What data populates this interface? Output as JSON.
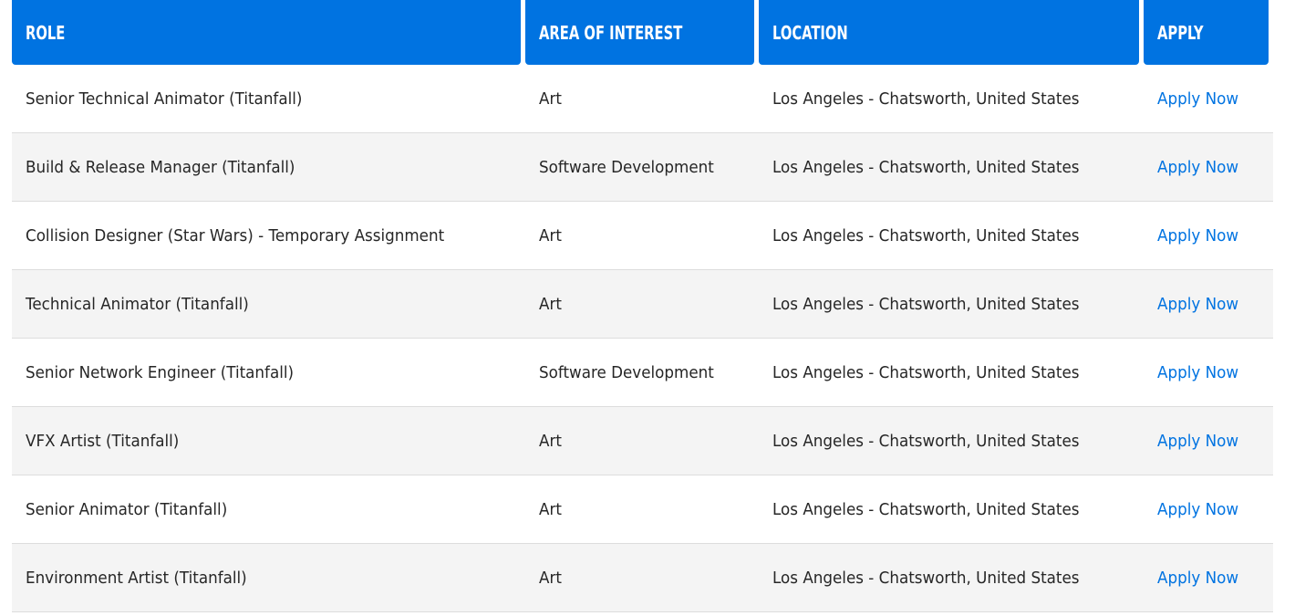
{
  "columns": {
    "role": "ROLE",
    "area": "AREA OF INTEREST",
    "location": "LOCATION",
    "apply": "APPLY"
  },
  "jobs": [
    {
      "role": "Senior Technical Animator (Titanfall)",
      "area": "Art",
      "location": "Los Angeles - Chatsworth, United States",
      "apply": "Apply Now"
    },
    {
      "role": "Build & Release Manager (Titanfall)",
      "area": "Software Development",
      "location": "Los Angeles - Chatsworth, United States",
      "apply": "Apply Now"
    },
    {
      "role": "Collision Designer (Star Wars) - Temporary Assignment",
      "area": "Art",
      "location": "Los Angeles - Chatsworth, United States",
      "apply": "Apply Now"
    },
    {
      "role": "Technical Animator (Titanfall)",
      "area": "Art",
      "location": "Los Angeles - Chatsworth, United States",
      "apply": "Apply Now"
    },
    {
      "role": "Senior Network Engineer (Titanfall)",
      "area": "Software Development",
      "location": "Los Angeles - Chatsworth, United States",
      "apply": "Apply Now"
    },
    {
      "role": "VFX Artist (Titanfall)",
      "area": "Art",
      "location": "Los Angeles - Chatsworth, United States",
      "apply": "Apply Now"
    },
    {
      "role": "Senior Animator (Titanfall)",
      "area": "Art",
      "location": "Los Angeles - Chatsworth, United States",
      "apply": "Apply Now"
    },
    {
      "role": "Environment Artist (Titanfall)",
      "area": "Art",
      "location": "Los Angeles - Chatsworth, United States",
      "apply": "Apply Now"
    }
  ],
  "colors": {
    "header_bg": "#0073e1",
    "header_text": "#ffffff",
    "link": "#0073e1",
    "row_alt": "#f4f4f4"
  }
}
